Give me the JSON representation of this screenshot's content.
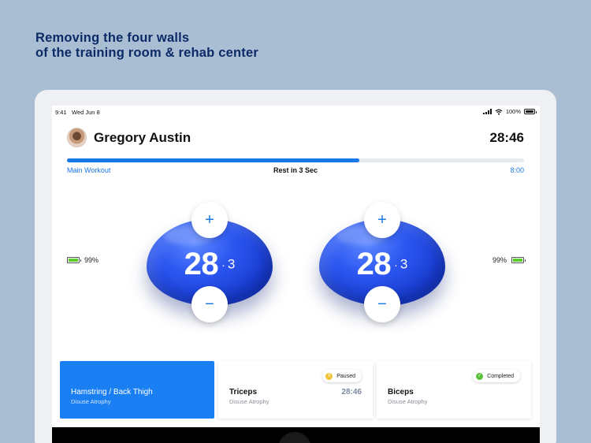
{
  "headline": {
    "line1": "Removing the four walls",
    "line2": "of the training room & rehab center"
  },
  "status_bar": {
    "time": "9:41",
    "date": "Wed Jun 8",
    "battery_text": "100%",
    "icons": [
      "signal-icon",
      "wifi-icon",
      "battery-icon"
    ]
  },
  "header": {
    "user_name": "Gregory Austin",
    "session_time": "28:46"
  },
  "workout": {
    "label": "Main Workout",
    "rest_text": "Rest in 3 Sec",
    "duration": "8:00",
    "progress": 0.64
  },
  "sensors": [
    {
      "battery_text": "99%",
      "battery_level": 0.99,
      "value": "28",
      "sub_value": "3",
      "plus_label": "+",
      "minus_label": "−"
    },
    {
      "battery_text": "99%",
      "battery_level": 0.99,
      "value": "28",
      "sub_value": "3",
      "plus_label": "+",
      "minus_label": "−"
    }
  ],
  "cards": [
    {
      "title": "Hamstring / Back Thigh",
      "subtitle": "Disuse Atrophy",
      "active": true
    },
    {
      "title": "Triceps",
      "subtitle": "Disuse Atrophy",
      "time": "28:46",
      "status": "Paused"
    },
    {
      "title": "Biceps",
      "subtitle": "Disuse Atrophy",
      "status": "Completed"
    }
  ],
  "colors": {
    "background": "#a9bdd3",
    "headline": "#0b2a66",
    "accent": "#1a78e6",
    "sensor_blue": "#2c57f0",
    "battery_green": "#5ccf2e",
    "paused": "#f1c232",
    "completed": "#59c23a"
  }
}
